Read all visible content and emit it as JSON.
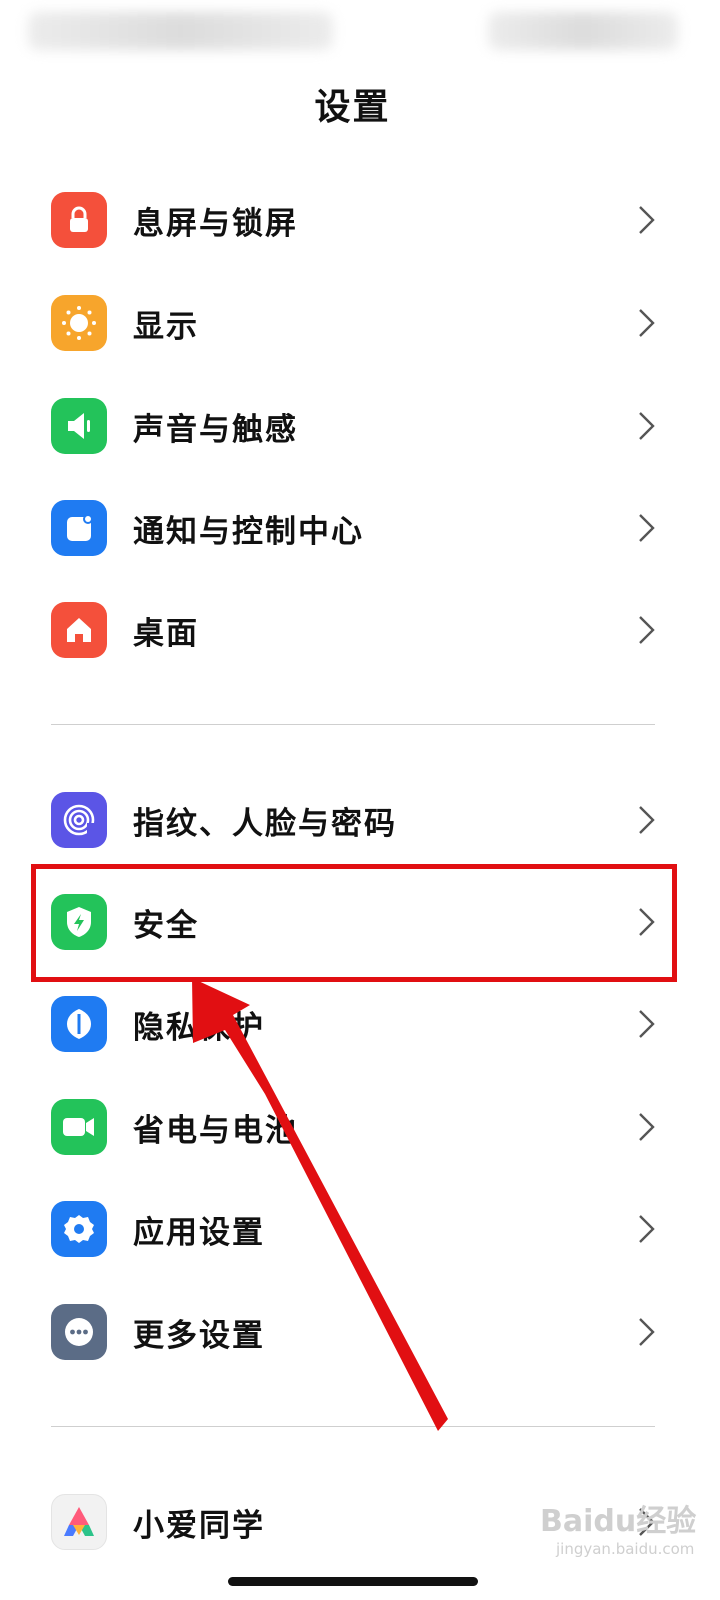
{
  "header": {
    "title": "设置"
  },
  "groups": [
    {
      "items": [
        {
          "label": "息屏与锁屏",
          "icon": "lock-icon",
          "color": "#f4503b"
        },
        {
          "label": "显示",
          "icon": "sun-icon",
          "color": "#f7a52c"
        },
        {
          "label": "声音与触感",
          "icon": "speaker-icon",
          "color": "#23c35a"
        },
        {
          "label": "通知与控制中心",
          "icon": "notification-icon",
          "color": "#1f7bf2"
        },
        {
          "label": "桌面",
          "icon": "home-icon",
          "color": "#f4503b"
        }
      ]
    },
    {
      "items": [
        {
          "label": "指纹、人脸与密码",
          "icon": "fingerprint-icon",
          "color": "#5b55e6"
        },
        {
          "label": "安全",
          "icon": "shield-icon",
          "color": "#23c35a"
        },
        {
          "label": "隐私保护",
          "icon": "privacy-icon",
          "color": "#1f7bf2"
        },
        {
          "label": "省电与电池",
          "icon": "battery-icon",
          "color": "#23c35a"
        },
        {
          "label": "应用设置",
          "icon": "gear-icon",
          "color": "#1f7bf2"
        },
        {
          "label": "更多设置",
          "icon": "more-icon",
          "color": "#5b6c86"
        }
      ]
    },
    {
      "items": [
        {
          "label": "小爱同学",
          "icon": "xiaoai-icon",
          "color": "#f2f2f2"
        }
      ]
    }
  ],
  "annotation": {
    "highlight_color": "#e10f12"
  },
  "watermark": {
    "text": "Baidu经验",
    "sub": "jingyan.baidu.com"
  }
}
